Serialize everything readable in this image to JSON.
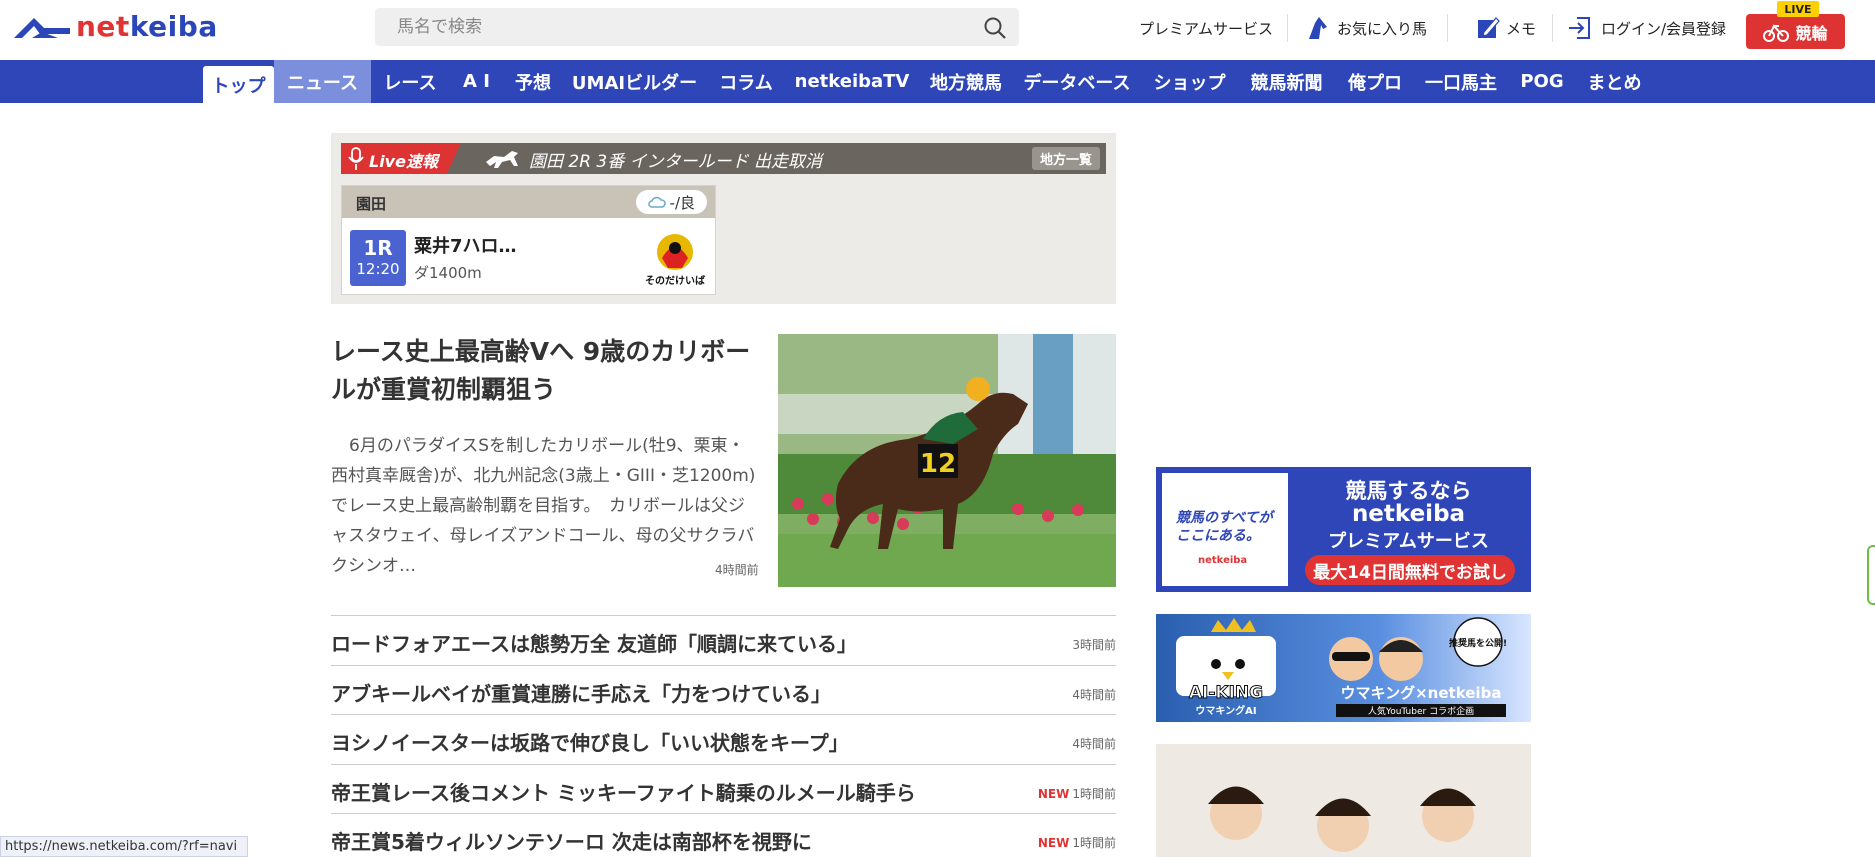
{
  "header": {
    "logo": "netkeiba",
    "search_placeholder": "馬名で検索",
    "premium": "プレミアムサービス",
    "favorites": "お気に入り馬",
    "memo": "メモ",
    "login": "ログイン/会員登録",
    "keirin": "競輪",
    "live_badge": "LIVE"
  },
  "nav": {
    "items": [
      "トップ",
      "ニュース",
      "レース",
      "A I",
      "予想",
      "UMAIビルダー",
      "コラム",
      "netkeibaTV",
      "地方競馬",
      "データベース",
      "ショップ",
      "競馬新聞",
      "俺プロ",
      "一口馬主",
      "POG",
      "まとめ"
    ]
  },
  "live": {
    "label": "Live速報",
    "ticker": "園田 2R 3番 インタールード 出走取消",
    "list_button": "地方一覧",
    "venue": "園田",
    "weather": "-/良",
    "race_no": "1R",
    "race_time": "12:20",
    "race_name": "粟井7ハロ…",
    "race_dist": "ダ1400m",
    "logo_text": "そのだけいば"
  },
  "feature": {
    "title": "レース史上最高齢Vへ 9歳のカリボールが重賞初制覇狙う",
    "body": "6月のパラダイスSを制したカリボール(牡9、栗東・西村真幸厩舎)が、北九州記念(3歳上・GIII・芝1200m)でレース史上最高齢制覇を目指す。　カリボールは父ジャスタウェイ、母レイズアンドコール、母の父サクラバクシンオ…",
    "time": "4時間前",
    "image_number": "12"
  },
  "news": [
    {
      "title": "ロードフォアエースは態勢万全 友道師「順調に来ている」",
      "time": "3時間前",
      "new": ""
    },
    {
      "title": "アブキールベイが重賞連勝に手応え「力をつけている」",
      "time": "4時間前",
      "new": ""
    },
    {
      "title": "ヨシノイースターは坂路で伸び良し「いい状態をキープ」",
      "time": "4時間前",
      "new": ""
    },
    {
      "title": "帝王賞レース後コメント ミッキーファイト騎乗のルメール騎手ら",
      "time": "1時間前",
      "new": "NEW"
    },
    {
      "title": "帝王賞5着ウィルソンテソーロ 次走は南部杯を視野に",
      "time": "1時間前",
      "new": "NEW"
    }
  ],
  "ads": {
    "premium_left_1": "競馬のすべてが",
    "premium_left_2": "ここにある。",
    "premium_left_brand": "netkeiba",
    "premium_t1": "競馬するなら",
    "premium_t2": "netkeiba",
    "premium_t3": "プレミアムサービス",
    "premium_cta": "最大14日間無料でお試し",
    "aiking_title": "AI-KING",
    "aiking_sub": "ウマキングAI",
    "aiking_collab": "ウマキング×netkeiba",
    "aiking_note": "人気YouTuber コラボ企画",
    "aiking_bubble": "推奨馬を公開!"
  },
  "status_url": "https://news.netkeiba.com/?rf=navi",
  "colors": {
    "brand_blue": "#2e46b8",
    "brand_red": "#e03434",
    "nav_hover": "#7c8fdc"
  }
}
